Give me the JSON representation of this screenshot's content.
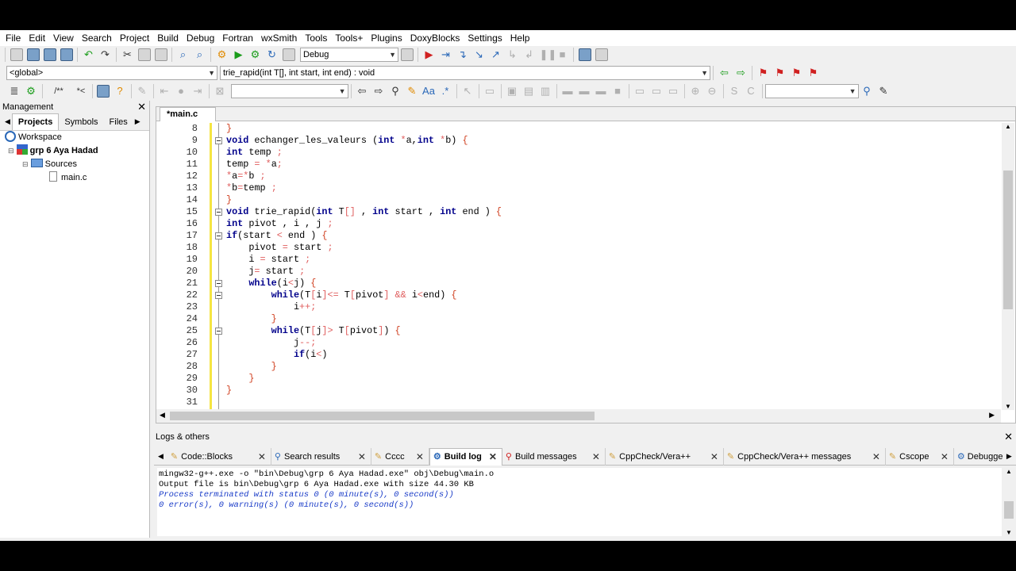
{
  "menu": [
    "File",
    "Edit",
    "View",
    "Search",
    "Project",
    "Build",
    "Debug",
    "Fortran",
    "wxSmith",
    "Tools",
    "Tools+",
    "Plugins",
    "DoxyBlocks",
    "Settings",
    "Help"
  ],
  "toolbar": {
    "build_target": "Debug"
  },
  "scope": {
    "left": "<global>",
    "right": "trie_rapid(int T[], int start, int end) : void"
  },
  "management": {
    "title": "Management",
    "tabs": [
      "Projects",
      "Symbols",
      "Files"
    ],
    "tree": {
      "workspace": "Workspace",
      "project": "grp 6 Aya Hadad",
      "folder": "Sources",
      "file": "main.c"
    }
  },
  "editor": {
    "tab_label": "*main.c",
    "lines": [
      {
        "n": "8",
        "t": "}"
      },
      {
        "n": "9",
        "t": "void echanger_les_valeurs (int *a,int *b) {"
      },
      {
        "n": "10",
        "t": "int temp ;"
      },
      {
        "n": "11",
        "t": "temp = *a;"
      },
      {
        "n": "12",
        "t": "*a=*b ;"
      },
      {
        "n": "13",
        "t": "*b=temp ;"
      },
      {
        "n": "14",
        "t": "}"
      },
      {
        "n": "15",
        "t": "void trie_rapid(int T[] , int start , int end ) {"
      },
      {
        "n": "16",
        "t": "int pivot , i , j ;"
      },
      {
        "n": "17",
        "t": "if(start < end ) {"
      },
      {
        "n": "18",
        "t": "    pivot = start ;"
      },
      {
        "n": "19",
        "t": "    i = start ;"
      },
      {
        "n": "20",
        "t": "    j= start ;"
      },
      {
        "n": "21",
        "t": "    while(i<j) {"
      },
      {
        "n": "22",
        "t": "        while(T[i]<= T[pivot] && i<end) {"
      },
      {
        "n": "23",
        "t": "            i++;"
      },
      {
        "n": "24",
        "t": "        }"
      },
      {
        "n": "25",
        "t": "        while(T[j]> T[pivot]) {"
      },
      {
        "n": "26",
        "t": "            j--;"
      },
      {
        "n": "27",
        "t": "            if(i<)"
      },
      {
        "n": "28",
        "t": "        }"
      },
      {
        "n": "29",
        "t": "    }"
      },
      {
        "n": "30",
        "t": "}"
      },
      {
        "n": "31",
        "t": ""
      }
    ]
  },
  "logs": {
    "title": "Logs & others",
    "tabs": [
      "Code::Blocks",
      "Search results",
      "Cccc",
      "Build log",
      "Build messages",
      "CppCheck/Vera++",
      "CppCheck/Vera++ messages",
      "Cscope",
      "Debugge"
    ],
    "active_tab": "Build log",
    "lines": [
      "mingw32-g++.exe  -o \"bin\\Debug\\grp 6 Aya Hadad.exe\" obj\\Debug\\main.o",
      "Output file is bin\\Debug\\grp 6 Aya Hadad.exe with size 44.30 KB",
      "Process terminated with status 0 (0 minute(s), 0 second(s))",
      "0 error(s), 0 warning(s) (0 minute(s), 0 second(s))"
    ]
  },
  "colors": {
    "keyword": "#00008b",
    "operator": "#e06060",
    "log_info": "#1a3cc8",
    "change_bar": "#f5e542"
  }
}
